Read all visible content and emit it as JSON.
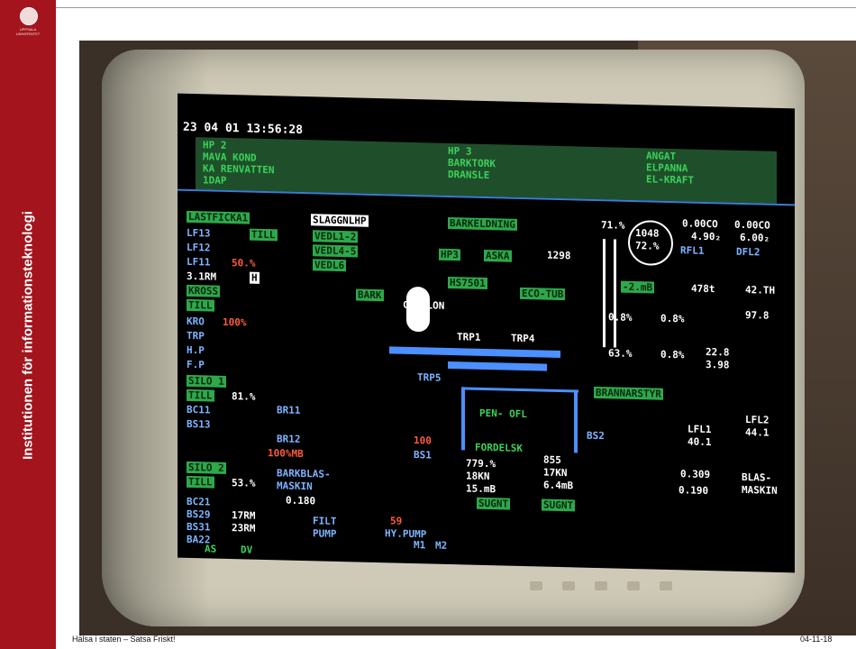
{
  "sidebar": {
    "title": "Institutionen för informationsteknologi",
    "logo_text": "UPPSALA UNIVERSITET"
  },
  "footer": {
    "left": "Hälsa i staten – Satsa Friskt!",
    "right": "04-11-18"
  },
  "screen": {
    "datetime": "23 04 01 13:56:28",
    "header": {
      "col1": [
        "HP 2",
        "MAVA KOND",
        "KA RENVATTEN",
        "1DAP"
      ],
      "col2": [
        "HP 3",
        "BARKTORK",
        "DRANSLE"
      ],
      "col3": [
        "ANGAT",
        "ELPANNA",
        "EL-KRAFT"
      ]
    },
    "labels": {
      "lastficka": "LASTFICKA1",
      "slaggnlhp": "SLAGGNLHP",
      "barkelodning": "BARKELDNING",
      "percent71": "71.%",
      "lf13": "LF13",
      "lf12": "LF12",
      "lf11": "LF11",
      "till": "TILL",
      "pct50": "50.%",
      "rm31": "3.1RM",
      "h": "H",
      "kross": "KROSS",
      "kro": "KRO",
      "pct100": "100%",
      "trp": "TRP",
      "hp": "H.P",
      "fp": "F.P",
      "silo1": "SILO 1",
      "pct81": "81.%",
      "bc11": "BC11",
      "bs13": "BS13",
      "br11": "BR11",
      "br12": "BR12",
      "pct100mb": "100%MB",
      "silo2": "SILO 2",
      "pct53": "53.%",
      "barkblas": "BARKBLAS-",
      "maskin": "MASKIN",
      "val0180": "0.180",
      "bc21": "BC21",
      "bs29": "BS29",
      "bs31": "BS31",
      "ba22": "BA22",
      "rm17": "17RM",
      "rm23": "23RM",
      "filt": "FILT",
      "pump": "PUMP",
      "hypump": "HY.PUMP",
      "vedl12": "VEDL1-2",
      "vedl45": "VEDL4-5",
      "vedl6": "VEDL6",
      "hp3": "HP3",
      "aska": "ASKA",
      "n1298": "1298",
      "hs7501": "HS7501",
      "ecotub": "ECO-TUB",
      "bark": "BARK",
      "cyklon": "CYK LON",
      "trp1": "TRP1",
      "trp4": "TRP4",
      "trp5": "TRP5",
      "penofl": "PEN- OFL",
      "fordelsk": "FORDELSK",
      "bs1": "BS1",
      "bs2": "BS2",
      "n100": "100",
      "val779": "779.%",
      "kn18": "18KN",
      "m15": "15.mB",
      "val855": "855",
      "kn17": "17KN",
      "m64": "6.4mB",
      "sugnt": "SUGNT",
      "n59": "59",
      "n1048": "1048",
      "pct72": "72.%",
      "val000a": "0.00CO",
      "val000b": "0.00CO",
      "val490": "4.90₂",
      "val600": "6.00₂",
      "rfl1": "RFL1",
      "dfl2": "DFL2",
      "m2": "-2.mB",
      "val478": "478t",
      "val42": "42.TH",
      "val08": "0.8%",
      "val97": "97.8",
      "val63": "63.%",
      "val228": "22.8",
      "val398": "3.98",
      "brannar": "BRANNARSTYR",
      "lfl1": "LFL1",
      "lfl2": "LFL2",
      "val401": "40.1",
      "val441": "44.1",
      "blas": "BLAS-",
      "maskin2": "MASKIN",
      "val0198": "0.190",
      "val0309": "0.309",
      "as": "AS",
      "dv": "DV",
      "m1": "M1",
      "m2b": "M2"
    }
  }
}
